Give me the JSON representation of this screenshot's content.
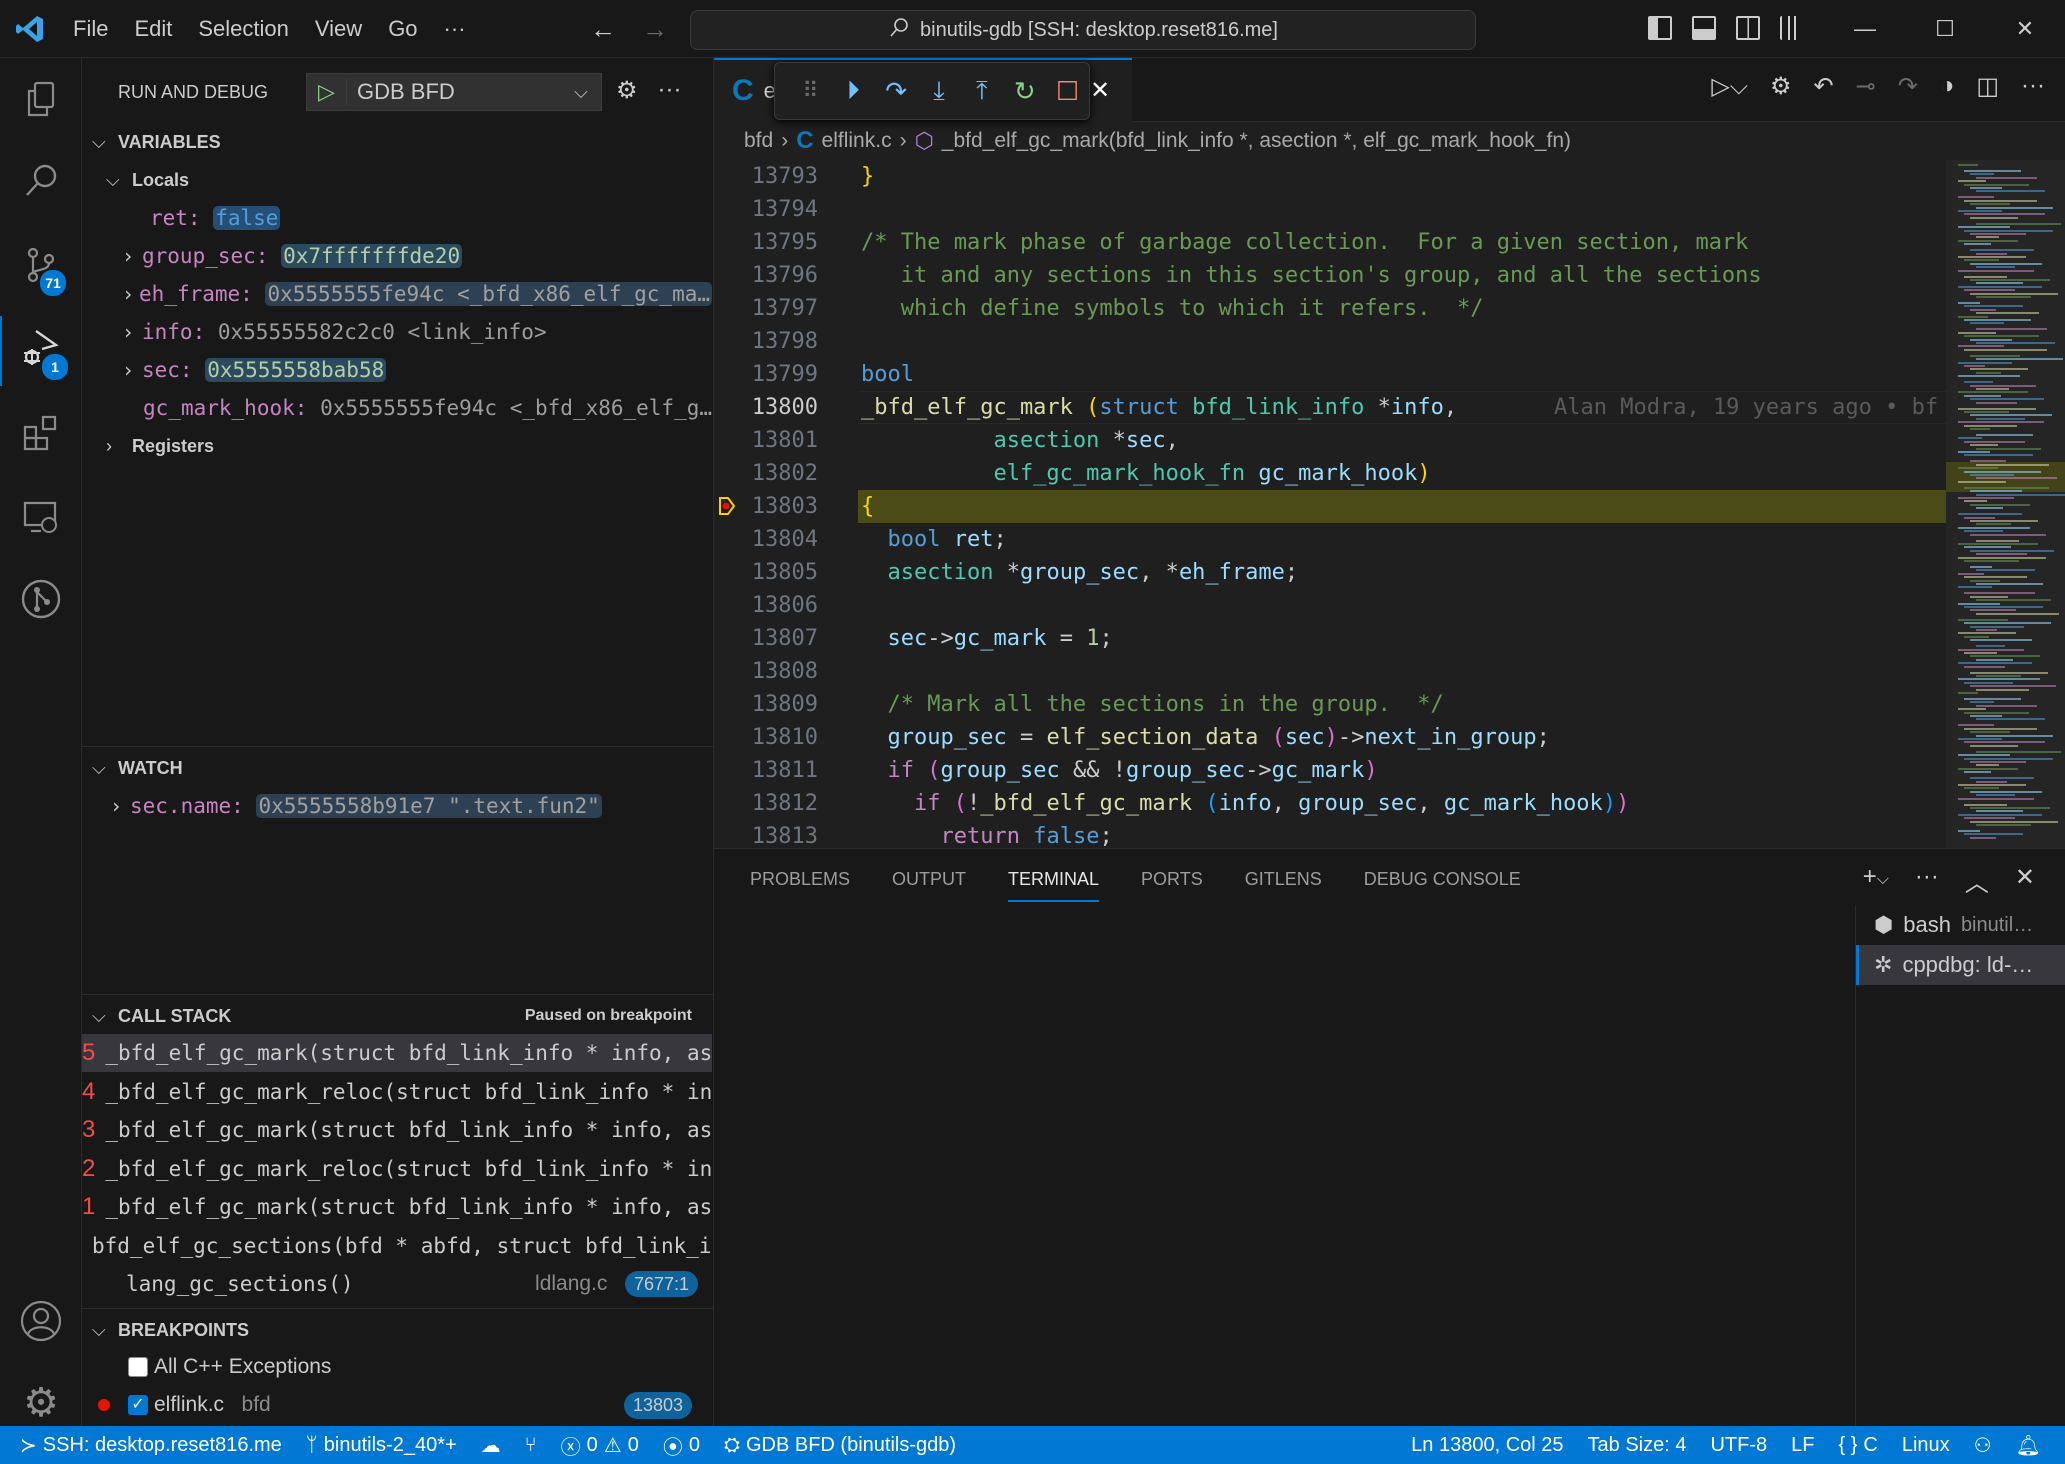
{
  "titlebar": {
    "menu": [
      "File",
      "Edit",
      "Selection",
      "View",
      "Go",
      "···"
    ],
    "command_center": "binutils-gdb [SSH: desktop.reset816.me]"
  },
  "activity_bar": {
    "items": [
      {
        "name": "explorer",
        "icon": "files-icon"
      },
      {
        "name": "search",
        "icon": "search-icon"
      },
      {
        "name": "source-control",
        "icon": "source-control-icon",
        "badge": "71"
      },
      {
        "name": "run-and-debug",
        "icon": "debug-icon",
        "badge": "1",
        "active": true
      },
      {
        "name": "extensions",
        "icon": "extensions-icon"
      },
      {
        "name": "remote-explorer",
        "icon": "remote-explorer-icon"
      },
      {
        "name": "gitlens",
        "icon": "gitlens-icon"
      }
    ],
    "bottom": [
      {
        "name": "accounts",
        "icon": "account-icon"
      },
      {
        "name": "manage",
        "icon": "gear-icon"
      }
    ]
  },
  "sidebar": {
    "title": "RUN AND DEBUG",
    "launch_config": "GDB BFD",
    "variables": {
      "title": "VARIABLES",
      "scope": "Locals",
      "items": [
        {
          "name": "ret:",
          "value": "false",
          "expandable": false
        },
        {
          "name": "group_sec:",
          "value": "0x7fffffffde20",
          "expandable": true
        },
        {
          "name": "eh_frame:",
          "value": "0x5555555fe94c <_bfd_x86_elf_gc_ma…",
          "expandable": true
        },
        {
          "name": "info:",
          "value": "0x55555582c2c0 <link_info>",
          "expandable": true
        },
        {
          "name": "sec:",
          "value": "0x5555558bab58",
          "expandable": true
        },
        {
          "name": "gc_mark_hook:",
          "value": "0x5555555fe94c <_bfd_x86_elf_g…",
          "expandable": false
        }
      ],
      "registers": "Registers"
    },
    "watch": {
      "title": "WATCH",
      "items": [
        {
          "name": "sec.name:",
          "value": "0x5555558b91e7 \".text.fun2\""
        }
      ]
    },
    "call_stack": {
      "title": "CALL STACK",
      "status": "Paused on breakpoint",
      "frames": [
        {
          "num": "5",
          "name": "_bfd_elf_gc_mark(struct bfd_link_info * info, asection * sec"
        },
        {
          "num": "4",
          "name": "_bfd_elf_gc_mark_reloc(struct bfd_link_info * info, asection"
        },
        {
          "num": "3",
          "name": "_bfd_elf_gc_mark(struct bfd_link_info * info, asection * sec"
        },
        {
          "num": "2",
          "name": "_bfd_elf_gc_mark_reloc(struct bfd_link_info * info, asection"
        },
        {
          "num": "1",
          "name": "_bfd_elf_gc_mark(struct bfd_link_info * info, asection * sec"
        },
        {
          "num": "",
          "name": "bfd_elf_gc_sections(bfd * abfd, struct bfd_link_info * info)"
        },
        {
          "num": "",
          "name": "lang_gc_sections()",
          "file": "ldlang.c",
          "line": "7677:1"
        }
      ]
    },
    "breakpoints": {
      "title": "BREAKPOINTS",
      "items": [
        {
          "label": "All C++ Exceptions",
          "checked": false
        },
        {
          "label": "elflink.c",
          "folder": "bfd",
          "line": "13803",
          "checked": true
        }
      ]
    }
  },
  "editor": {
    "tab_file": "elflink.c",
    "breadcrumb": [
      "bfd",
      "elflink.c",
      "_bfd_elf_gc_mark(bfd_link_info *, asection *, elf_gc_mark_hook_fn)"
    ],
    "current_line": "13800",
    "paused_line": "13803",
    "blame": "Alan Modra, 19 years ago • bf",
    "line_numbers": [
      "13793",
      "13794",
      "13795",
      "13796",
      "13797",
      "13798",
      "13799",
      "13800",
      "13801",
      "13802",
      "13803",
      "13804",
      "13805",
      "13806",
      "13807",
      "13808",
      "13809",
      "13810",
      "13811",
      "13812",
      "13813"
    ]
  },
  "panel": {
    "tabs": [
      "PROBLEMS",
      "OUTPUT",
      "TERMINAL",
      "PORTS",
      "GITLENS",
      "DEBUG CONSOLE"
    ],
    "active_tab": "TERMINAL",
    "terminals": [
      {
        "name": "bash",
        "detail": "binutil…"
      },
      {
        "name": "cppdbg: ld-…",
        "detail": "",
        "active": true
      }
    ]
  },
  "statusbar": {
    "remote": "SSH: desktop.reset816.me",
    "branch": "binutils-2_40*+",
    "errors": "0",
    "warnings": "0",
    "ports": "0",
    "debug": "GDB BFD (binutils-gdb)",
    "position": "Ln 13800, Col 25",
    "tab_size": "Tab Size: 4",
    "encoding": "UTF-8",
    "eol": "LF",
    "language": "C",
    "os": "Linux"
  }
}
